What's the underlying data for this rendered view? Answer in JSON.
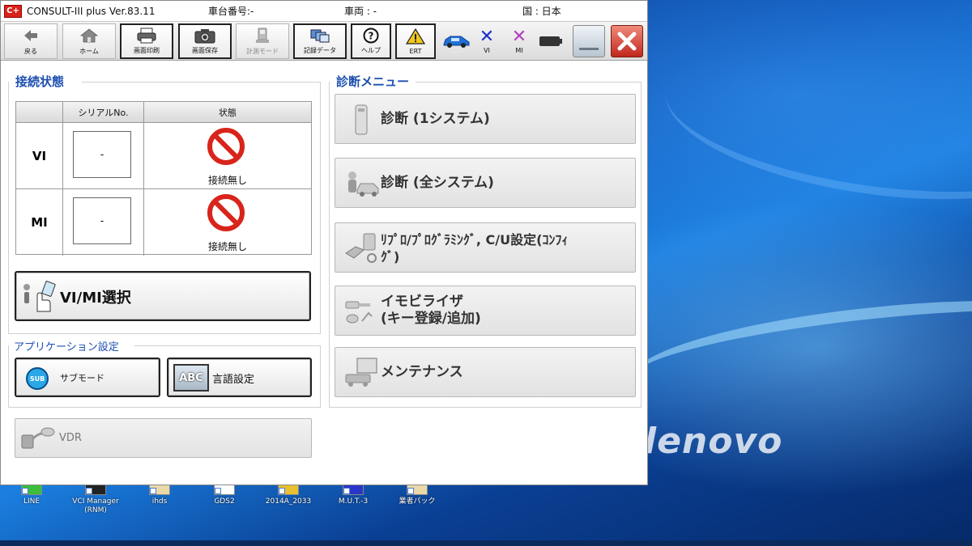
{
  "window": {
    "logo": "C+",
    "title": "CONSULT-III plus  Ver.83.11",
    "chassis_label": "車台番号:-",
    "vehicle_label": "車両 : -",
    "country_label": "国 : 日本"
  },
  "toolbar": {
    "back": "戻る",
    "home": "ホーム",
    "print": "画面印刷",
    "save": "画面保存",
    "measure": "計測モード",
    "records": "記録データ",
    "help": "ヘルプ",
    "ert": "ERT",
    "vi": "VI",
    "mi": "MI"
  },
  "connection": {
    "title": "接続状態",
    "col_serial": "シリアルNo.",
    "col_state": "状態",
    "rows": [
      {
        "name": "VI",
        "serial": "-",
        "state": "接続無し"
      },
      {
        "name": "MI",
        "serial": "-",
        "state": "接続無し"
      }
    ],
    "select_button": "VI/MI選択"
  },
  "app_settings": {
    "title": "アプリケーション設定",
    "sub_mode": "サブモード",
    "sub_badge": "SUB",
    "language": "言語設定",
    "abc_badge": "ABC"
  },
  "vdr": {
    "label": "VDR"
  },
  "diagnosis_menu": {
    "title": "診断メニュー",
    "items": [
      {
        "line1": "診断 (1システム)",
        "line2": ""
      },
      {
        "line1": "診断 (全システム)",
        "line2": ""
      },
      {
        "line1": "ﾘﾌﾟﾛ/ﾌﾟﾛｸﾞﾗﾐﾝｸﾞ, C/U設定(ｺﾝﾌｨ",
        "line2": "ｸﾞ)"
      },
      {
        "line1": "イモビライザ",
        "line2": "(キー登録/追加)"
      },
      {
        "line1": "メンテナンス",
        "line2": ""
      }
    ]
  },
  "desktop": {
    "brand": "lenovo",
    "icons": [
      {
        "label": "LINE"
      },
      {
        "label": "VCI Manager\n(RNM)"
      },
      {
        "label": "ihds"
      },
      {
        "label": "GDS2"
      },
      {
        "label": "2014A_2033"
      },
      {
        "label": "M.U.T.-3"
      },
      {
        "label": "業者パック"
      }
    ]
  },
  "colors": {
    "section_title": "#1d4fb0",
    "close_red": "#c0281c",
    "vi_x": "#1a2fd0",
    "mi_x": "#b040c0"
  }
}
